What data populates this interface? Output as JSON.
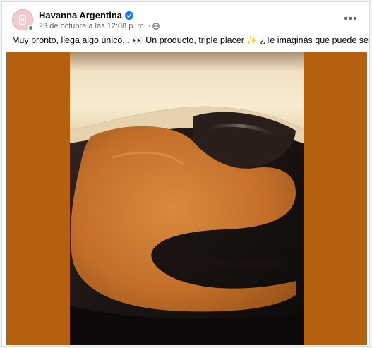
{
  "post": {
    "author": "Havanna Argentina",
    "verified": true,
    "timestamp": "23 de octubre a las 12:08 p. m.",
    "separator": "·",
    "audience_icon": "globe-icon",
    "more_label": "•••",
    "caption": "Muy pronto, llega algo único... 👀 Un producto, triple placer ✨ ¿Te imaginás qué puede ser?"
  },
  "colors": {
    "verified": "#1877f2",
    "media_background": "#b5600f",
    "avatar_background": "#f7c9cf"
  },
  "icons": [
    "havanna-logo-icon",
    "verified-badge-icon",
    "globe-icon",
    "more-options-icon"
  ]
}
